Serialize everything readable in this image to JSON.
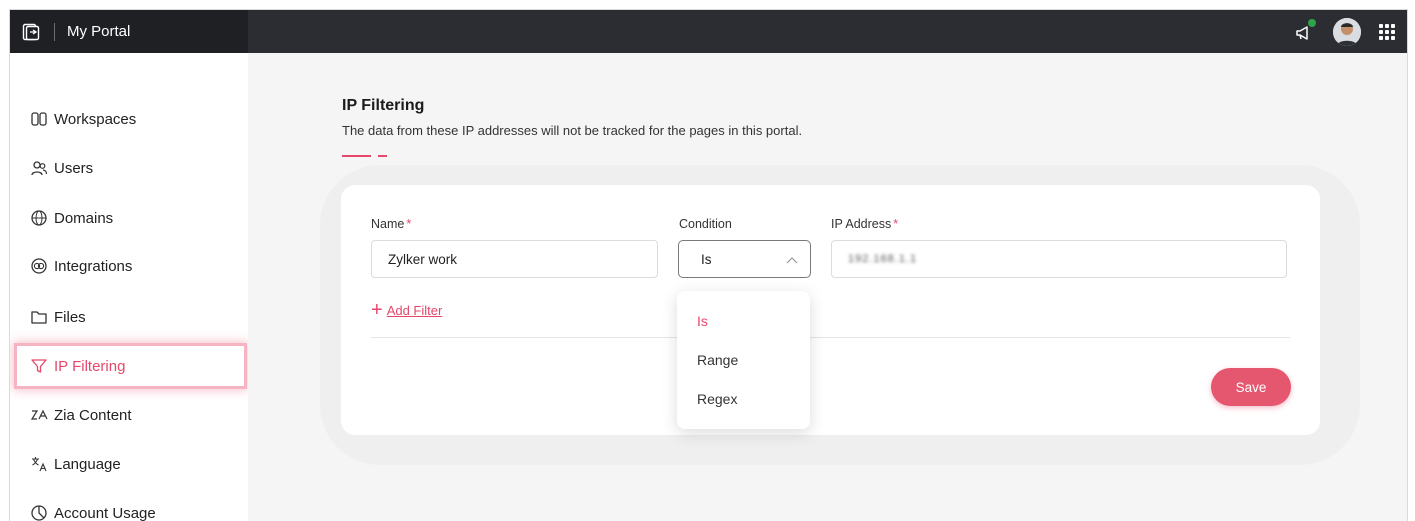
{
  "topbar": {
    "portal_name": "My Portal",
    "accent": "#e5486a"
  },
  "sidebar": {
    "items": [
      {
        "label": "Workspaces",
        "icon": "workspaces-icon"
      },
      {
        "label": "Users",
        "icon": "users-icon"
      },
      {
        "label": "Domains",
        "icon": "domains-icon"
      },
      {
        "label": "Integrations",
        "icon": "integrations-icon"
      },
      {
        "label": "Files",
        "icon": "folder-icon"
      },
      {
        "label": "IP Filtering",
        "icon": "filter-icon",
        "active": true
      },
      {
        "label": "Zia Content",
        "icon": "zia-icon"
      },
      {
        "label": "Language",
        "icon": "language-icon"
      },
      {
        "label": "Account Usage",
        "icon": "pie-chart-icon"
      }
    ]
  },
  "page": {
    "title": "IP Filtering",
    "description": "The data from these IP addresses will not be tracked for the pages in this portal."
  },
  "form": {
    "name_label": "Name",
    "required_mark": "*",
    "name_value": "Zylker work",
    "condition_label": "Condition",
    "condition_value": "Is",
    "ip_label": "IP Address",
    "ip_value": "192.168.1.1",
    "add_filter": "Add Filter",
    "save": "Save"
  },
  "dropdown": {
    "options": [
      "Is",
      "Range",
      "Regex"
    ],
    "selected": "Is"
  }
}
